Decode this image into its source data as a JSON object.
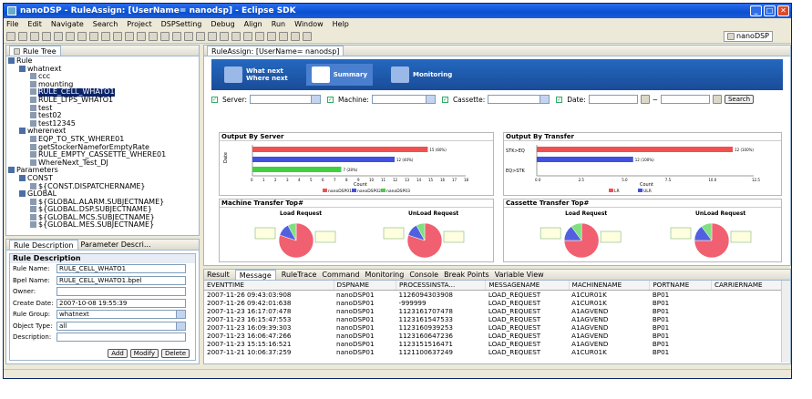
{
  "window": {
    "title": "nanoDSP - RuleAssign: [UserName= nanodsp] - Eclipse SDK",
    "close_glyph": "✕",
    "min_glyph": "_",
    "max_glyph": "□"
  },
  "menu": [
    "File",
    "Edit",
    "Navigate",
    "Search",
    "Project",
    "DSPSetting",
    "Debug",
    "Align",
    "Run",
    "Window",
    "Help"
  ],
  "perspective": {
    "label": "nanoDSP"
  },
  "rule_tree": {
    "tab": "Rule Tree",
    "items": [
      {
        "label": "Rule",
        "indent": 0
      },
      {
        "label": "whatnext",
        "indent": 1
      },
      {
        "label": "ccc",
        "indent": 2
      },
      {
        "label": "mounting",
        "indent": 2
      },
      {
        "label": "RULE_CELL_WHATO1",
        "indent": 2,
        "selected": true
      },
      {
        "label": "RULE_LTPS_WHATO1",
        "indent": 2
      },
      {
        "label": "test",
        "indent": 2
      },
      {
        "label": "test02",
        "indent": 2
      },
      {
        "label": "test12345",
        "indent": 2
      },
      {
        "label": "wherenext",
        "indent": 1
      },
      {
        "label": "EQP_TO_STK_WHERE01",
        "indent": 2
      },
      {
        "label": "getStockerNameforEmptyRate",
        "indent": 2
      },
      {
        "label": "RULE_EMPTY_CASSETTE_WHERE01",
        "indent": 2
      },
      {
        "label": "WhereNext_Test_DJ",
        "indent": 2
      },
      {
        "label": "Parameters",
        "indent": 0
      },
      {
        "label": "CONST",
        "indent": 1
      },
      {
        "label": "${CONST.DISPATCHERNAME}",
        "indent": 2
      },
      {
        "label": "GLOBAL",
        "indent": 1
      },
      {
        "label": "${GLOBAL.ALARM.SUBJECTNAME}",
        "indent": 2
      },
      {
        "label": "${GLOBAL.DSP.SUBJECTNAME}",
        "indent": 2
      },
      {
        "label": "${GLOBAL.MCS.SUBJECTNAME}",
        "indent": 2
      },
      {
        "label": "${GLOBAL.MES.SUBJECTNAME}",
        "indent": 2
      }
    ]
  },
  "rule_desc": {
    "tabs": [
      "Rule Description",
      "Parameter Descri..."
    ],
    "header": "Rule Description",
    "fields": [
      {
        "label": "Rule Name:",
        "value": "RULE_CELL_WHATO1",
        "type": "text"
      },
      {
        "label": "Bpel Name:",
        "value": "RULE_CELL_WHATO1.bpel",
        "type": "text"
      },
      {
        "label": "Owner:",
        "value": "",
        "type": "text"
      },
      {
        "label": "Create Date:",
        "value": "2007-10-08 19:55:39",
        "type": "text"
      },
      {
        "label": "Rule Group:",
        "value": "whatnext",
        "type": "select"
      },
      {
        "label": "Object Type:",
        "value": "all",
        "type": "select"
      },
      {
        "label": "Description:",
        "value": "",
        "type": "text"
      }
    ],
    "buttons": [
      "Add",
      "Modify",
      "Delete"
    ]
  },
  "editor": {
    "tab": "RuleAssign: [UserName= nanodsp]",
    "nav": [
      {
        "label1": "What next",
        "label2": "Where next"
      },
      {
        "label1": "Summary",
        "label2": ""
      },
      {
        "label1": "Monitoring",
        "label2": ""
      }
    ],
    "filters": [
      {
        "label": "Server:"
      },
      {
        "label": "Machine:"
      },
      {
        "label": "Cassette:"
      },
      {
        "label": "Date:"
      }
    ],
    "date_sep": "~",
    "search_label": "Search"
  },
  "colors": {
    "red": "#f05050",
    "blue": "#4050e0",
    "green": "#40d040",
    "pie_red": "#f06070",
    "pie_blue": "#5060e0",
    "pie_green": "#80e080"
  },
  "chart_data": [
    {
      "type": "bar",
      "title": "Output By Server",
      "orientation": "horizontal",
      "xlabel": "Count",
      "ylabel": "Date",
      "x_ticks": [
        "0",
        "1",
        "2",
        "3",
        "4",
        "5",
        "6",
        "7",
        "8",
        "9",
        "10",
        "11",
        "12",
        "13",
        "14",
        "15",
        "16",
        "17",
        "18"
      ],
      "series": [
        {
          "name": "nanoDSP01",
          "values": [
            14.8
          ],
          "label": "15 (60%)"
        },
        {
          "name": "nanoDSP02",
          "values": [
            12
          ],
          "label": "12 (40%)"
        },
        {
          "name": "nanoDSP03",
          "values": [
            7.5
          ],
          "label": "7 (28%)"
        }
      ],
      "xlim": [
        0,
        18
      ]
    },
    {
      "type": "bar",
      "title": "Output By Transfer",
      "orientation": "horizontal",
      "xlabel": "Count",
      "categories": [
        "STK>EQ",
        "EQ>STK"
      ],
      "x_ticks": [
        "0.0",
        "2.5",
        "5.0",
        "7.5",
        "10.0",
        "12.5"
      ],
      "series": [
        {
          "name": "LR",
          "values": [
            12.2
          ],
          "label": "12 (100%)"
        },
        {
          "name": "ULR",
          "values": [
            6
          ],
          "label": "12 (100%)"
        }
      ],
      "xlim": [
        0,
        13.5
      ]
    },
    {
      "type": "pie",
      "title": "Machine Transfer Top#",
      "subtitles": [
        "Load Request",
        "UnLoad Request"
      ],
      "slices": [
        0.8,
        0.12,
        0.08
      ]
    },
    {
      "type": "pie",
      "title": "Cassette Transfer Top#",
      "subtitles": [
        "Load Request",
        "UnLoad Request"
      ],
      "slices": [
        0.75,
        0.15,
        0.1
      ]
    }
  ],
  "bottom": {
    "tabs": [
      "Result",
      "Message",
      "RuleTrace",
      "Command",
      "Monitoring",
      "Console",
      "Break Points",
      "Variable View"
    ],
    "columns": [
      "EVENTTIME",
      "DSPNAME",
      "PROCESSINSTA...",
      "MESSAGENAME",
      "MACHINENAME",
      "PORTNAME",
      "CARRIERNAME"
    ],
    "rows": [
      [
        "2007-11-26 09:43:03:908",
        "nanoDSP01",
        "1126094303908",
        "LOAD_REQUEST",
        "A1CUR01K",
        "BP01",
        ""
      ],
      [
        "2007-11-26 09:42:01:638",
        "nanoDSP01",
        "-999999",
        "LOAD_REQUEST",
        "A1CUR01K",
        "BP01",
        ""
      ],
      [
        "2007-11-23 16:17:07:478",
        "nanoDSP01",
        "1123161707478",
        "LOAD_REQUEST",
        "A1AGVEND",
        "BP01",
        ""
      ],
      [
        "2007-11-23 16:15:47:553",
        "nanoDSP01",
        "1123161547533",
        "LOAD_REQUEST",
        "A1AGVEND",
        "BP01",
        ""
      ],
      [
        "2007-11-23 16:09:39:303",
        "nanoDSP01",
        "1123160939253",
        "LOAD_REQUEST",
        "A1AGVEND",
        "BP01",
        ""
      ],
      [
        "2007-11-23 16:06:47:266",
        "nanoDSP01",
        "1123160647236",
        "LOAD_REQUEST",
        "A1AGVEND",
        "BP01",
        ""
      ],
      [
        "2007-11-23 15:15:16:521",
        "nanoDSP01",
        "1123151516471",
        "LOAD_REQUEST",
        "A1AGVEND",
        "BP01",
        ""
      ],
      [
        "2007-11-21 10:06:37:259",
        "nanoDSP01",
        "1121100637249",
        "LOAD_REQUEST",
        "A1CUR01K",
        "BP01",
        ""
      ]
    ]
  }
}
